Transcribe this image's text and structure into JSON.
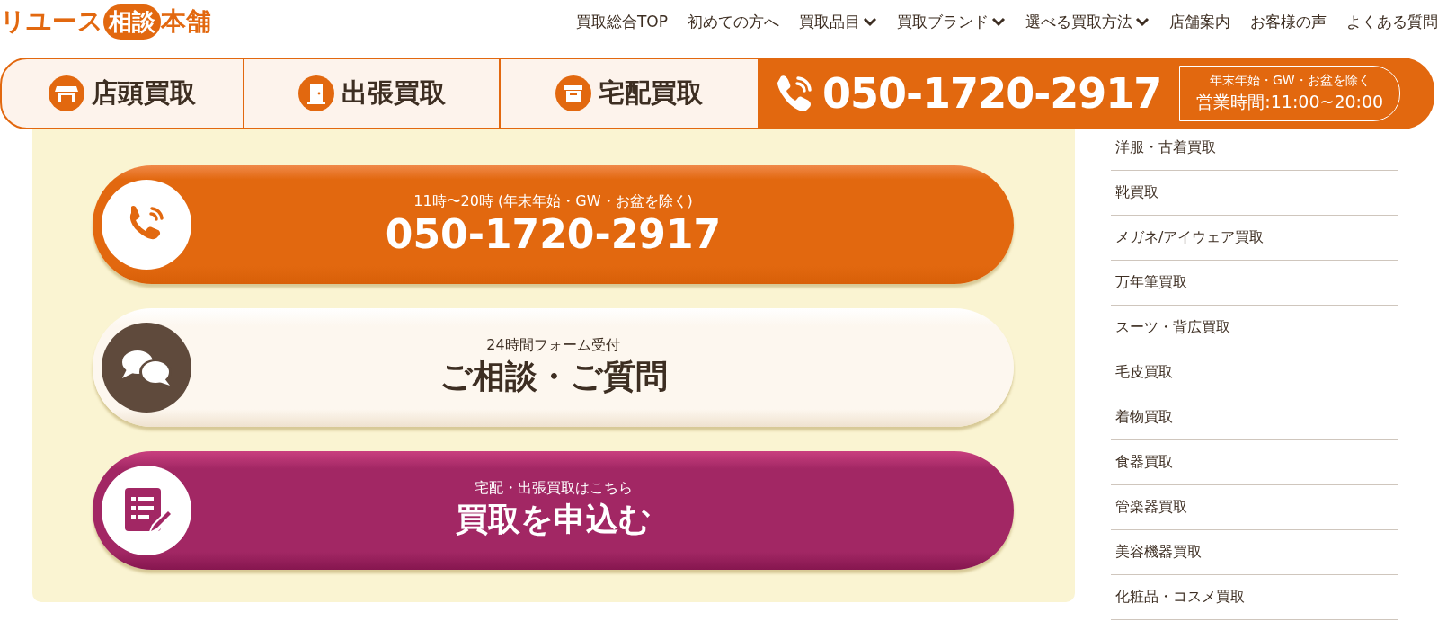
{
  "header": {
    "logo": {
      "part_1": "リユース",
      "part_2": "相談",
      "part_3": "本舗"
    },
    "nav": [
      {
        "label": "買取総合TOP",
        "dropdown": false
      },
      {
        "label": "初めての方へ",
        "dropdown": false
      },
      {
        "label": "買取品目",
        "dropdown": true
      },
      {
        "label": "買取ブランド",
        "dropdown": true
      },
      {
        "label": "選べる買取方法",
        "dropdown": true
      },
      {
        "label": "店舗案内",
        "dropdown": false
      },
      {
        "label": "お客様の声",
        "dropdown": false
      },
      {
        "label": "よくある質問",
        "dropdown": false
      }
    ]
  },
  "sticky_bar": {
    "methods": [
      {
        "kind": "store",
        "label": "店頭買取"
      },
      {
        "kind": "visit",
        "label": "出張買取"
      },
      {
        "kind": "delivery",
        "label": "宅配買取"
      }
    ],
    "phone": "050-1720-2917",
    "note": "年末年始・GW・お盆を除く",
    "hours": "営業時間:11:00~20:00"
  },
  "contact_buttons": [
    {
      "kind": "phone",
      "subtitle": "11時〜20時 (年末年始・GW・お盆を除く)",
      "title": "050-1720-2917"
    },
    {
      "kind": "inquiry",
      "subtitle": "24時間フォーム受付",
      "title": "ご相談・ご質問"
    },
    {
      "kind": "apply",
      "subtitle": "宅配・出張買取はこちら",
      "title": "買取を申込む"
    }
  ],
  "sidebar": {
    "items": [
      "洋服・古着買取",
      "靴買取",
      "メガネ/アイウェア買取",
      "万年筆買取",
      "スーツ・背広買取",
      "毛皮買取",
      "着物買取",
      "食器買取",
      "管楽器買取",
      "美容機器買取",
      "化粧品・コスメ買取"
    ]
  }
}
